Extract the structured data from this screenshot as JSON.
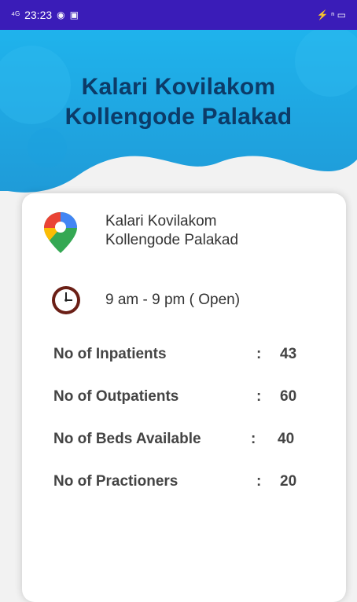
{
  "status_bar": {
    "time": "23:23",
    "signal_text": "⁴ᴳ",
    "right_icons": "⚡ ⁿ ▭"
  },
  "header": {
    "title": "Kalari Kovilakom\nKollengode Palakad",
    "colors": {
      "top": "#1fb3ec",
      "bottom": "#1f9bd8",
      "title": "#0c3b68"
    }
  },
  "card": {
    "location": "Kalari Kovilakom\nKollengode Palakad",
    "hours": "9 am - 9 pm ( Open)",
    "stats": [
      {
        "label": "No of Inpatients",
        "colon": ":",
        "value": "43"
      },
      {
        "label": "No of Outpatients",
        "colon": ":",
        "value": "60"
      },
      {
        "label": "No of Beds Available",
        "colon": ":",
        "value": "40"
      },
      {
        "label": "No of Practioners",
        "colon": ":",
        "value": "20"
      }
    ]
  },
  "icons": {
    "location": "map-pin-icon",
    "clock": "clock-icon"
  }
}
